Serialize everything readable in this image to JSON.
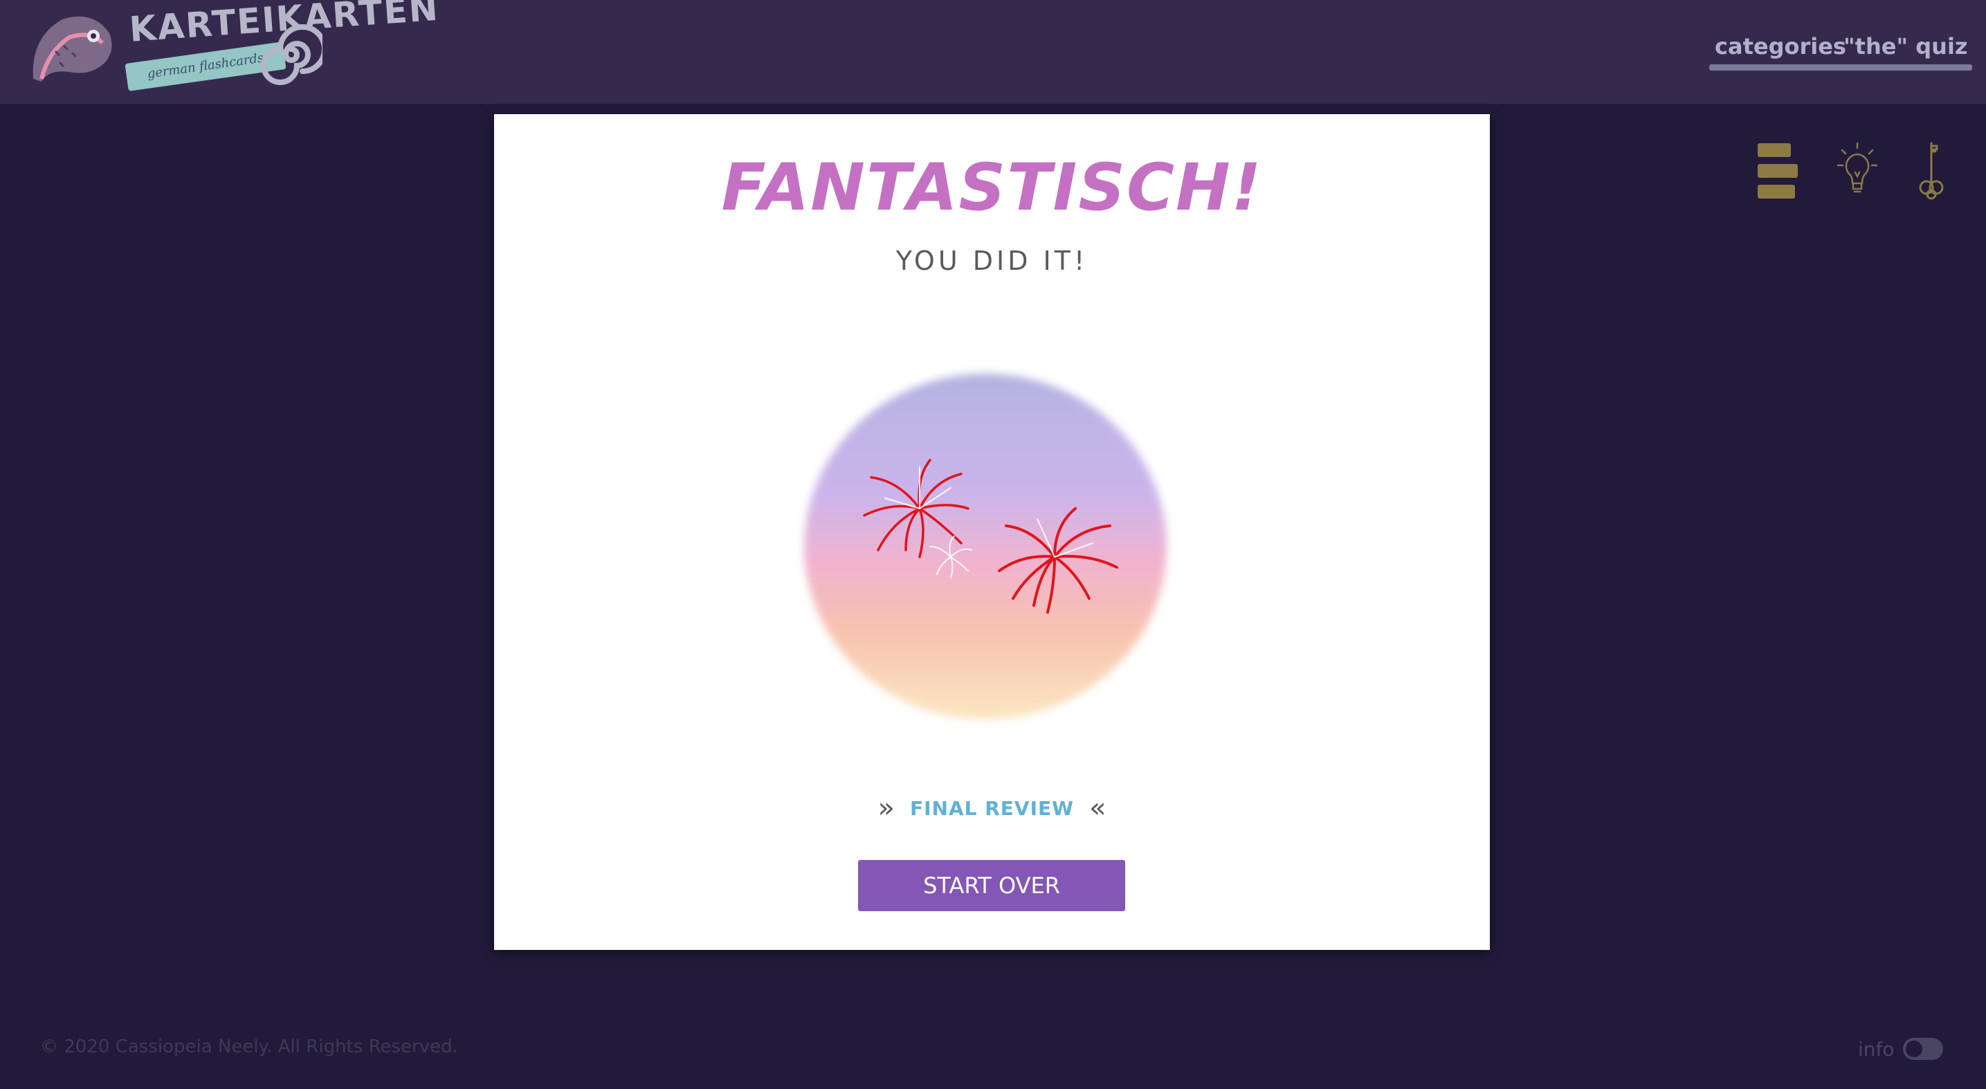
{
  "header": {
    "logo_title": "KARTEIKARTEN",
    "logo_subtitle": "german flashcards",
    "nav": [
      {
        "label": "categories"
      },
      {
        "label": "\"the\" quiz"
      }
    ]
  },
  "side_icons": [
    "menu-icon",
    "lightbulb-icon",
    "key-icon"
  ],
  "card": {
    "title": "FANTASTISCH!",
    "subtitle": "YOU DID IT!",
    "review_left_chevron": "»",
    "review_label": "FINAL REVIEW",
    "review_right_chevron": "«",
    "button_label": "START OVER"
  },
  "footer": {
    "copyright": "© 2020 Cassiopeia Neely. All Rights Reserved.",
    "info_label": "info",
    "info_toggle_on": false
  },
  "colors": {
    "background": "#211a3a",
    "topbar": "#352a4e",
    "title": "#c471c4",
    "accent_button": "#8456b5",
    "review_link": "#5fb1d8",
    "icons_gold": "#8c7a44"
  }
}
